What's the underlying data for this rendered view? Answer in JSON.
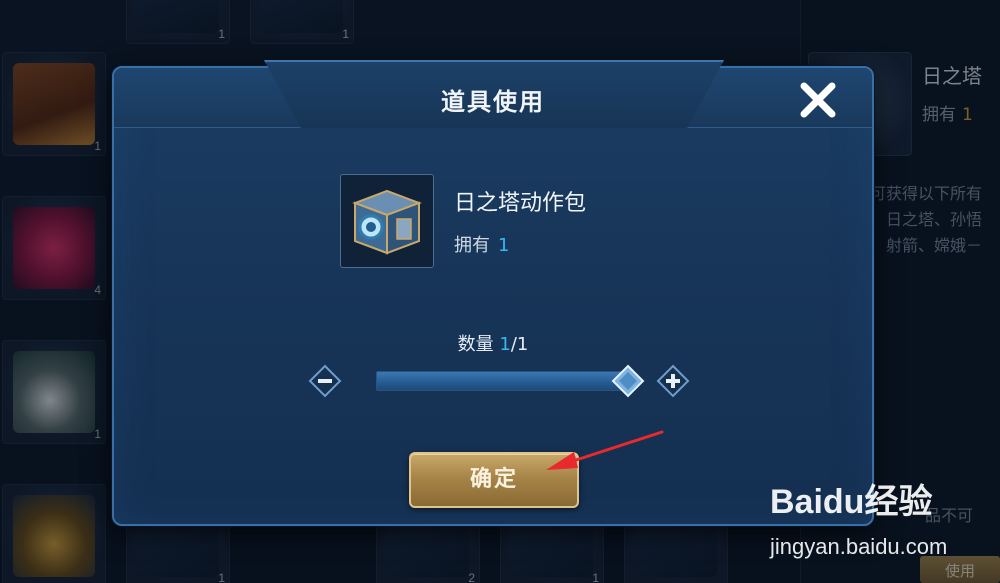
{
  "inventory": {
    "slots": [
      {
        "art": "chest",
        "count": "1"
      },
      {
        "art": "heart",
        "count": "4"
      },
      {
        "art": "panda",
        "count": "1"
      },
      {
        "art": "gold",
        "count": ""
      },
      {
        "art": "dark",
        "count": "1"
      },
      {
        "art": "dark",
        "count": "1"
      },
      {
        "art": "dark",
        "count": "1"
      },
      {
        "art": "dark",
        "count": "2"
      },
      {
        "art": "dark",
        "count": "1"
      },
      {
        "art": "dark",
        "count": ""
      }
    ]
  },
  "side_panel": {
    "title": "日之塔",
    "owned_label": "拥有",
    "owned_count": "1",
    "desc_lines": [
      "可获得以下所有",
      "、日之塔、孙悟",
      "、射箭、嫦娥－"
    ],
    "footer_text": "品不可",
    "use_button": "使用"
  },
  "modal": {
    "title": "道具使用",
    "close_icon": "close-icon",
    "item": {
      "name": "日之塔动作包",
      "owned_label": "拥有",
      "owned_count": "1"
    },
    "quantity": {
      "label": "数量",
      "current": "1",
      "max": "/1",
      "fraction": 1.0
    },
    "confirm_button": "确定"
  },
  "colors": {
    "accent_blue": "#38b8f0",
    "gold_button": "#a78548",
    "arrow_red": "#e8292d"
  },
  "watermark": {
    "logo": "Baidu经验",
    "url": "jingyan.baidu.com"
  }
}
